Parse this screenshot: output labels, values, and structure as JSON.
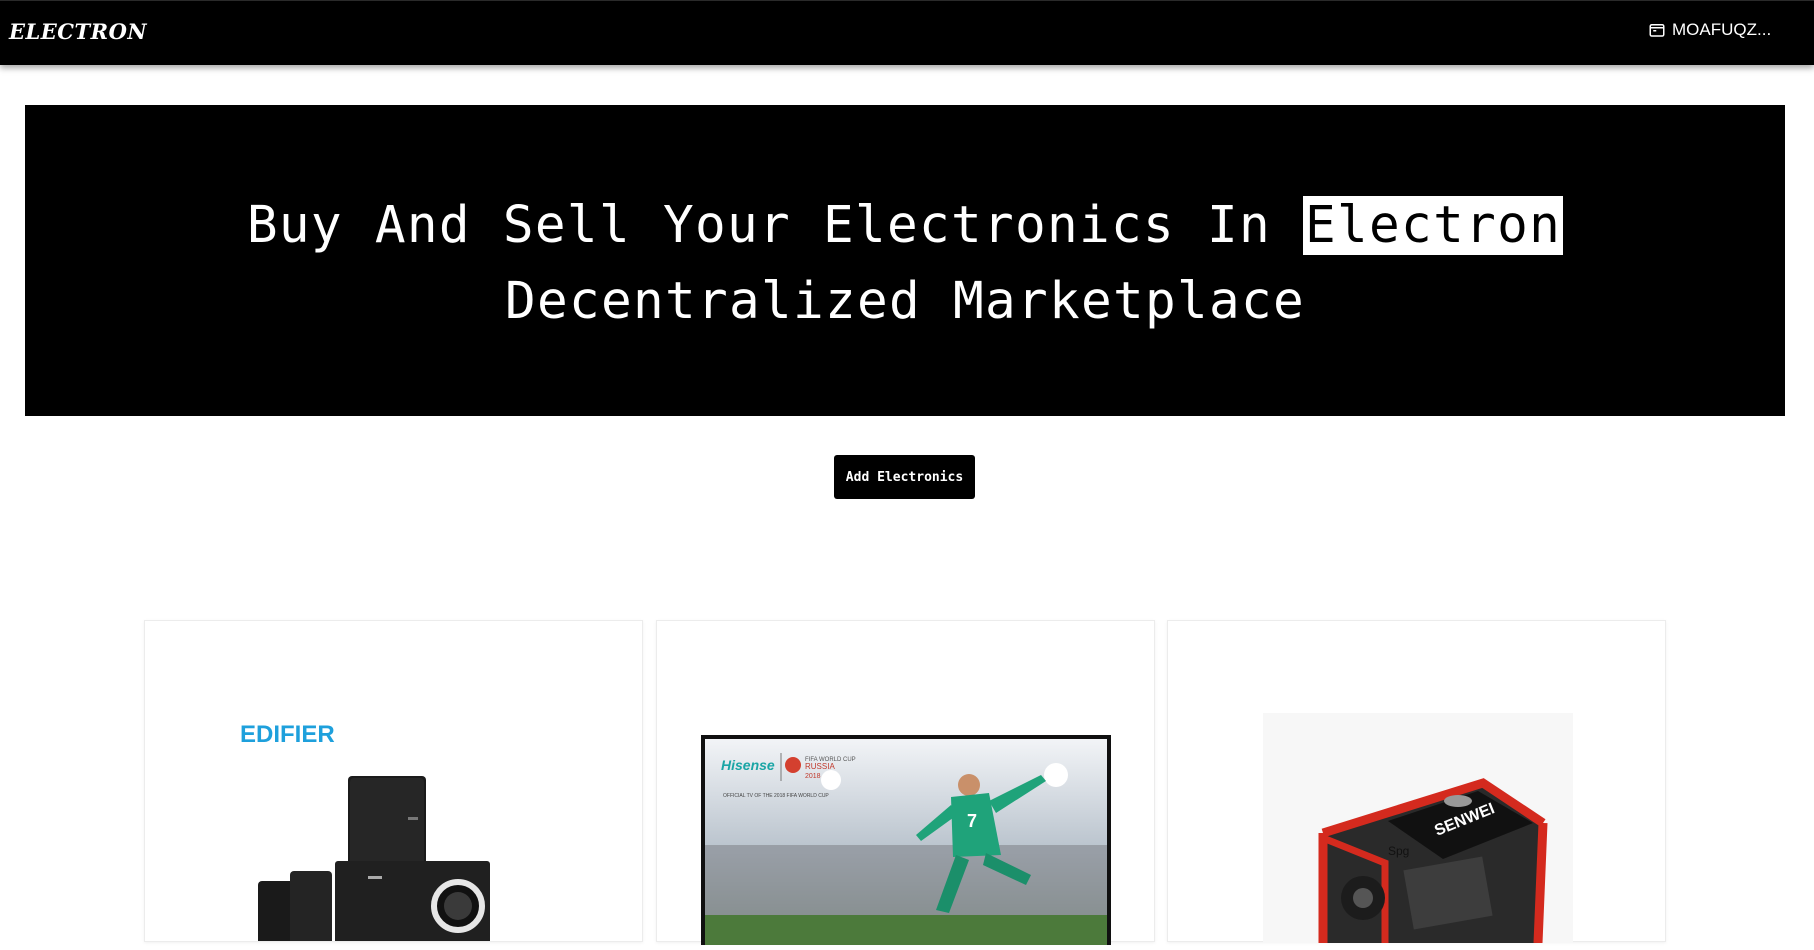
{
  "navbar": {
    "brand": "ELECTRON",
    "wallet_address": "MOAFUQZ..."
  },
  "hero": {
    "title_prefix": "Buy And Sell Your Electronics In ",
    "title_highlight": "Electron",
    "title_suffix": "Decentralized Marketplace"
  },
  "actions": {
    "add_button_label": "Add Electronics"
  },
  "products": [
    {
      "image": "speaker-system-image",
      "brand_label": "EDIFIER",
      "speaker_badge": "EDIFIER"
    },
    {
      "image": "television-image",
      "brand_label": "Hisense",
      "tagline": "OFFICIAL TV OF THE 2018 FIFA WORLD CUP",
      "badge_line1": "FIFA WORLD CUP",
      "badge_line2": "RUSSIA",
      "badge_line3": "2018",
      "jersey_number": "7"
    },
    {
      "image": "generator-image",
      "brand_label": "SENWEI",
      "tag": "Spg"
    }
  ],
  "icons": {
    "wallet": "wallet-icon"
  },
  "colors": {
    "navbar_bg": "#000000",
    "hero_bg": "#000000",
    "highlight_bg": "#ffffff",
    "edifier_blue": "#1ea0dc",
    "generator_red": "#d42a1e"
  }
}
